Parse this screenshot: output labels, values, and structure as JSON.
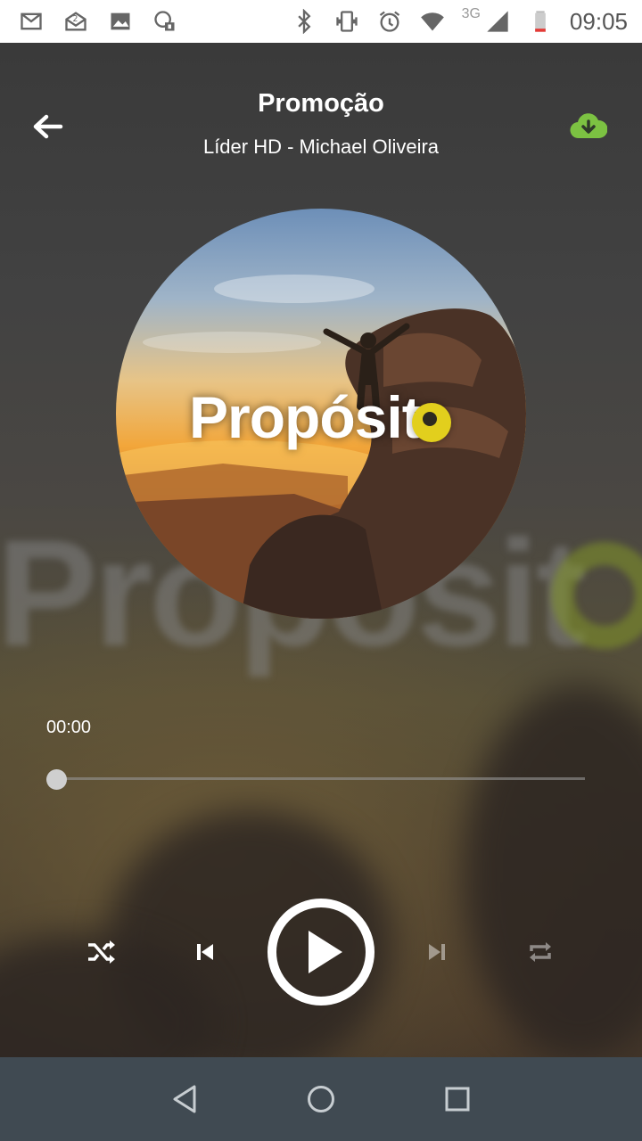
{
  "status_bar": {
    "icons": [
      "gmail-icon",
      "mail-open-icon",
      "gallery-icon",
      "app-notification-icon",
      "bluetooth-icon",
      "vibrate-icon",
      "alarm-icon",
      "wifi-icon",
      "signal-icon",
      "battery-low-icon"
    ],
    "network_label": "3G",
    "time": "09:05"
  },
  "header": {
    "title": "Promoção",
    "subtitle": "Líder HD - Michael Oliveira",
    "back_icon": "arrow-back-icon",
    "download_icon": "cloud-download-icon",
    "download_color": "#7cc242"
  },
  "album": {
    "logo_text": "Propósit",
    "logo_accent_color": "#e2cf1d"
  },
  "background": {
    "logo_text": "Propósit"
  },
  "player": {
    "current_time": "00:00",
    "progress": 0,
    "controls": [
      "shuffle-icon",
      "skip-previous-icon",
      "play-icon",
      "skip-next-icon",
      "repeat-icon"
    ]
  },
  "nav_bar": {
    "buttons": [
      "nav-back-icon",
      "nav-home-icon",
      "nav-recents-icon"
    ],
    "color": "#404a52"
  }
}
